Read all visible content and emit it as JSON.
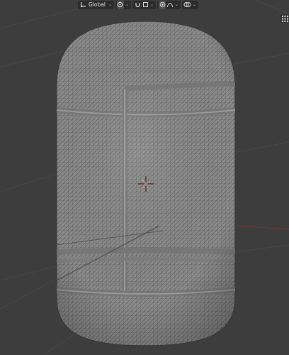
{
  "header": {
    "transform_orientation": "Global",
    "chevron": "⌄"
  },
  "icons": {
    "orientation": "axis-gizmo-icon",
    "pivot": "pivot-point-icon",
    "snap": "snap-magnet-icon",
    "proportional": "proportional-edit-icon",
    "falloff": "falloff-curve-icon",
    "overlay": "overlay-rings-icon",
    "grid": "grid-view-icon"
  },
  "colors": {
    "viewport_bg": "#3d3d3d",
    "mesh_fill": "#8a8a8a",
    "wire": "#5a5a5a",
    "x_axis": "#8a3a3a",
    "cursor_red": "#c83a2a"
  }
}
